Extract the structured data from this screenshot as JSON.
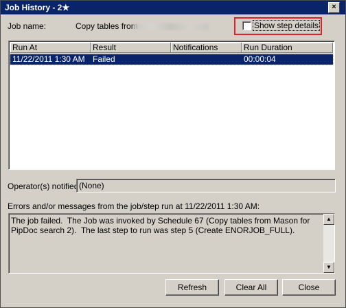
{
  "window": {
    "title": "Job History - 2★",
    "close_glyph": "×"
  },
  "job": {
    "name_label": "Job name:",
    "name_value": "Copy tables from",
    "show_step_details_label": "Show step details",
    "show_step_details_checked": false
  },
  "grid": {
    "columns": [
      "Run At",
      "Result",
      "Notifications",
      "Run Duration"
    ],
    "rows": [
      {
        "run_at": "11/22/2011  1:30 AM",
        "result": "Failed",
        "notifications": "",
        "duration": "00:00:04"
      }
    ]
  },
  "operators": {
    "label": "Operator(s) notified:",
    "value": "(None)"
  },
  "messages": {
    "label": "Errors and/or messages from the job/step run at 11/22/2011  1:30 AM:",
    "text": "The job failed.  The Job was invoked by Schedule 67 (Copy tables from Mason for PipDoc search 2).  The last step to run was step 5 (Create ENORJOB_FULL)."
  },
  "buttons": {
    "refresh": "Refresh",
    "clear_all": "Clear All",
    "close": "Close"
  },
  "colors": {
    "titlebar": "#0a246a",
    "highlight_box": "#e0202a",
    "selected_row": "#0a246a"
  }
}
